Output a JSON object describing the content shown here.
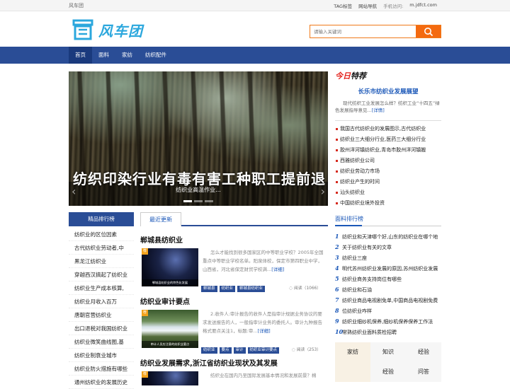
{
  "topbar": {
    "site_name": "风车团",
    "links": [
      "TAG标签",
      "网站导航"
    ],
    "mobile_label": "手机访问:",
    "mobile_url": "m.jdfct.com"
  },
  "header": {
    "logo_text": "风车团",
    "search_placeholder": "请输入关键词"
  },
  "nav": {
    "items": [
      "首页",
      "面料",
      "家纺",
      "纺织配件"
    ]
  },
  "slider": {
    "caption_big": "纺织印染行业有毒有害工种职工提前退",
    "caption_small": "纺织业高温作业..."
  },
  "today": {
    "title_red": "今日",
    "title_rest": "特荐",
    "headline": "长乐市纺织业发展展望",
    "description": "现代纺织工业发展怎么样？纺织工业“十四五”绿色发展指导意见...",
    "more": "[详情]",
    "items": [
      "我国古代纺织业的发展图示,古代纺织业",
      "纺织业三大细分行业,医药三大细分行业",
      "胶州洋河镇纺织业,青岛市胶州洋河镇搬",
      "西雅纺织业公司",
      "纺织业劳动力市场",
      "纺织业产生的时间",
      "汕头纺织业",
      "中国纺织业境外投资"
    ]
  },
  "ranking": {
    "tab": "精品排行榜",
    "items": [
      "纺织业的区位因素",
      "古代纺织业劳动者,中",
      "黑龙江纺织业",
      "穿越西汉搞起了纺织业",
      "纺织业生产成本核算,",
      "纺织业月收入百万",
      "唐朝官营纺织业",
      "出口退税对我国纺织业",
      "纺织业微笑曲线图,基",
      "纺织业制衰业城市",
      "纺织业防火措施有哪些",
      "通州纺织业的发展历史"
    ]
  },
  "latest": {
    "tab": "最近更新",
    "articles": [
      {
        "title": "郸城县纺织业",
        "badge": "荐",
        "thumb_caption": "郸城县纺织业的特色化发展",
        "body": "怎么才能找到很多国家区的中等职业学校？2005年全国重点中等职业学校名单。阳泉体校，保定市第四职业中学，山西省，河北省保定财贸学校满...",
        "more": "[详细]",
        "tags": [
          "郸城县",
          "纺织业",
          "郸城县纺织业"
        ],
        "read": "阅读（1066）"
      },
      {
        "title": "纺织业审计要点",
        "badge": "荐",
        "thumb_caption": "审计人员应注意的纺织业要点",
        "body": "2.收件人:审计报告的收件人是指审计规据业务协议的要求发送报告的人，一般指审计业务的委托人。审计九种报告格式要点关注1，标题:审...",
        "more": "[详细]",
        "tags": [
          "纺织业",
          "要点",
          "审计",
          "纺织业审计要点"
        ],
        "read": "阅读（253）"
      },
      {
        "title": "纺织业发展需求,浙江省纺织业现状及其发展",
        "badge": "荐",
        "thumb_caption": "",
        "body": "纺织业在国内乃至国际发展基本情况和发展前景？棉",
        "more": "",
        "tags": [],
        "read": ""
      }
    ]
  },
  "face_ranking": {
    "title": "面料排行榜",
    "items": [
      "纺织业和天津哪个好,山东的纺织业在哪个地",
      "关于纺织业有关的文章",
      "纺织业三座",
      "明代苏州纺织业发展的原因,苏州纺织业发展",
      "纺织业商务支持岗位有哪些",
      "纺织业和石油",
      "纺织业商品电视剧免单,中国商品电视剧免费",
      "位纺织业咋样",
      "纺织业细纱机保养,细纱机保养保养工作法",
      "常熟纺织业面料质检招聘"
    ]
  },
  "tag_grid": {
    "rows": [
      [
        "家纺",
        "知识",
        "经验"
      ],
      [
        "",
        "经验",
        "问答"
      ]
    ]
  }
}
